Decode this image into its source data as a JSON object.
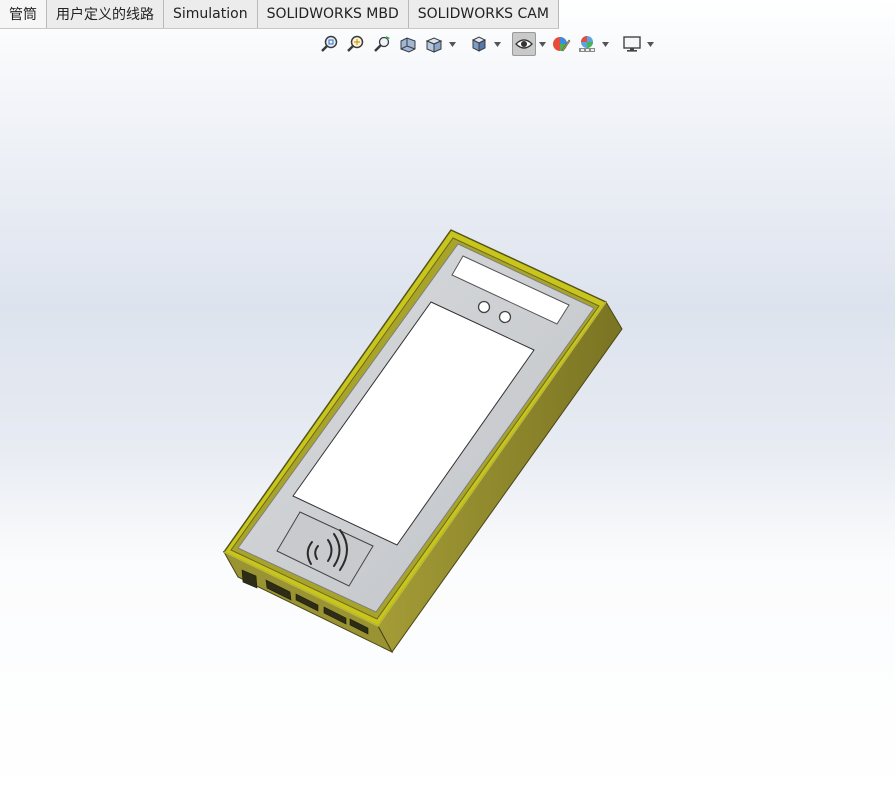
{
  "tabs": [
    "管筒",
    "用户定义的线路",
    "Simulation",
    "SOLIDWORKS MBD",
    "SOLIDWORKS CAM"
  ],
  "toolbar": {
    "icons": [
      "zoom-to-fit-icon",
      "zoom-to-area-icon",
      "previous-view-icon",
      "section-view-icon",
      "view-orientation-icon",
      "display-style-icon",
      "hide-show-items-icon",
      "edit-appearance-icon",
      "apply-scene-icon",
      "view-settings-icon"
    ]
  },
  "colors": {
    "bezel": "#c3c31a",
    "body_side": "#8f8a2c",
    "face_plate": "#cfd1d3",
    "screen": "#ffffff"
  }
}
